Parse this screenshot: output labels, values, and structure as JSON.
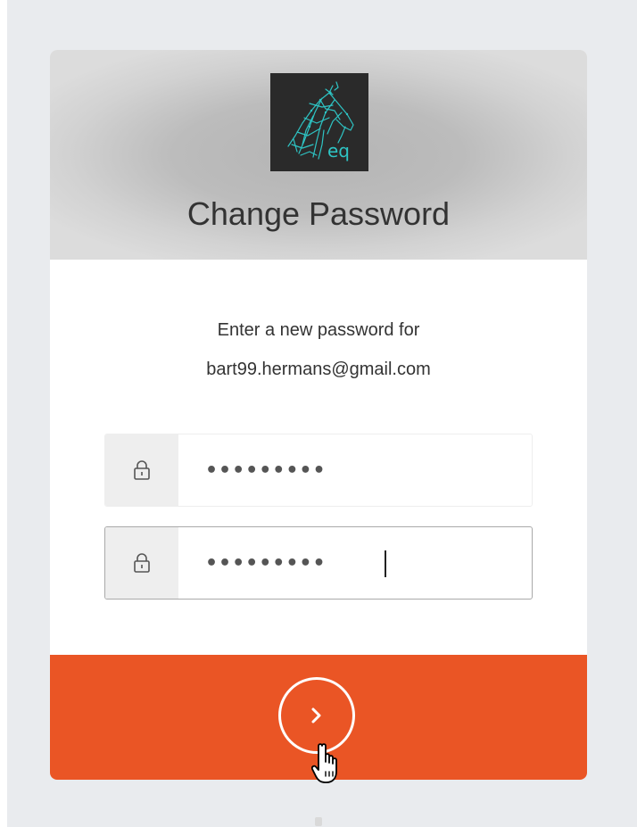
{
  "header": {
    "logo_text": "eq",
    "title": "Change Password"
  },
  "instructions": {
    "line1": "Enter a new password for",
    "email": "bart99.hermans@gmail.com"
  },
  "fields": {
    "new_password": {
      "icon": "lock-icon",
      "masked_value": "•••••••••"
    },
    "confirm_password": {
      "icon": "lock-icon",
      "masked_value": "•••••••••",
      "focused": true
    }
  },
  "submit": {
    "icon": "chevron-right-icon"
  },
  "colors": {
    "accent": "#ea5525",
    "header_bg": "#bcbcbc",
    "logo_bg": "#2a2a2a",
    "logo_line": "#2ec4c4",
    "page_bg": "#e9ebee"
  }
}
